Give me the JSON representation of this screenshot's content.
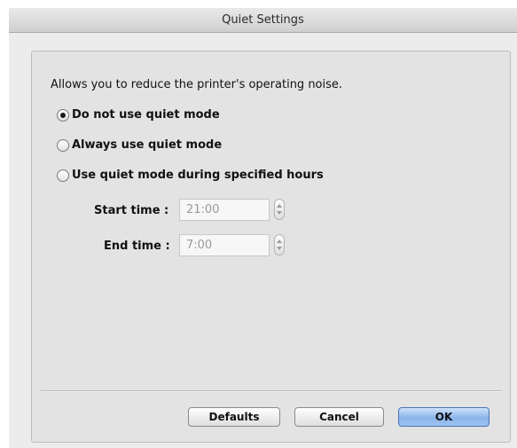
{
  "window": {
    "title": "Quiet Settings"
  },
  "description": "Allows you to reduce the printer's operating noise.",
  "options": [
    {
      "label": "Do not use quiet mode",
      "selected": true
    },
    {
      "label": "Always use quiet mode",
      "selected": false
    },
    {
      "label": "Use quiet mode during specified hours",
      "selected": false
    }
  ],
  "start_time": {
    "label": "Start time :",
    "value": "21:00"
  },
  "end_time": {
    "label": "End time :",
    "value": "7:00"
  },
  "buttons": {
    "defaults": "Defaults",
    "cancel": "Cancel",
    "ok": "OK"
  }
}
